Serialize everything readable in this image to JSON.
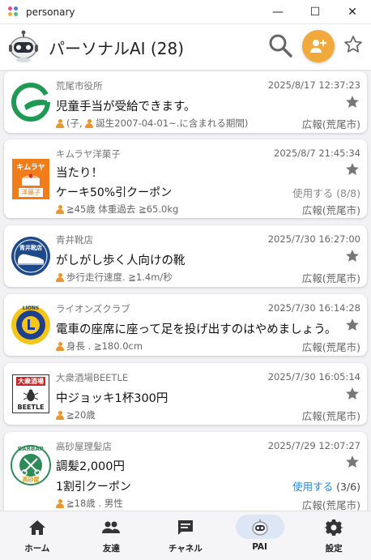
{
  "window": {
    "title": "personary",
    "minimize": "—",
    "maximize": "☐",
    "close": "✕"
  },
  "header": {
    "title": "パーソナルAI (28)"
  },
  "cards": [
    {
      "sender": "荒尾市役所",
      "time": "2025/8/17 12:37:23",
      "message": "児童手当が受給できます。",
      "conditions": "(子,",
      "conditions2": "誕生2007-04-01~.に含まれる期間)",
      "publisher": "広報(荒尾市)"
    },
    {
      "sender": "キムラヤ洋菓子",
      "time": "2025/8/7 21:45:34",
      "message": "当たり！",
      "message2": "ケーキ50%引クーポン",
      "conditions": "≧45歳 体重過去 ≧65.0kg",
      "use_label": "使用する",
      "use_count": "(8/8)",
      "publisher": "広報(荒尾市)",
      "logo_top": "キムラヤ",
      "logo_bottom": "洋菓子"
    },
    {
      "sender": "青井靴店",
      "time": "2025/7/30 16:27:00",
      "message": "がしがし歩く人向けの靴",
      "conditions": "歩行走行速度. ≧1.4m/秒",
      "publisher": "広報(荒尾市)",
      "logo_text": "青井靴店"
    },
    {
      "sender": "ライオンズクラブ",
      "time": "2025/7/30 16:14:28",
      "message": "電車の座席に座って足を投げ出すのはやめましょう。",
      "conditions": "身長 . ≧180.0cm",
      "publisher": "広報(荒尾市)",
      "logo_text": "LIONS"
    },
    {
      "sender": "大衆酒場BEETLE",
      "time": "2025/7/30 16:05:14",
      "message": "中ジョッキ1杯300円",
      "conditions": "≧20歳",
      "publisher": "広報(荒尾市)",
      "logo_top": "大衆酒場",
      "logo_bottom": "BEETLE"
    },
    {
      "sender": "高砂屋理髪店",
      "time": "2025/7/29 12:07:27",
      "message": "調髪2,000円",
      "message2": "1割引クーポン",
      "conditions": "≧18歳 . 男性",
      "use_label": "使用する",
      "use_count": "(3/6)",
      "publisher": "広報(荒尾市)",
      "logo_top": "BARBAR",
      "logo_bottom": "高砂屋"
    }
  ],
  "nav": [
    {
      "label": "ホーム",
      "icon": "home-icon"
    },
    {
      "label": "友達",
      "icon": "people-icon"
    },
    {
      "label": "チャネル",
      "icon": "chat-icon"
    },
    {
      "label": "PAI",
      "icon": "robot-icon"
    },
    {
      "label": "設定",
      "icon": "gear-icon"
    }
  ],
  "colors": {
    "accent": "#f2a93b",
    "link": "#1e88e5",
    "person": "#e8962f",
    "nav_selected": "#dce6f5"
  }
}
